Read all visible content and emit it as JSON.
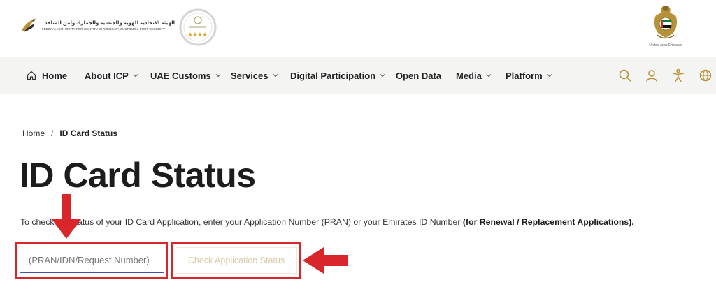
{
  "header": {
    "logo_text_ar": "الهيئة الاتحادية للهوية والجنسية والجمارك وأمن المنافذ",
    "logo_text_en": "FEDERAL AUTHORITY FOR IDENTITY, CITIZENSHIP, CUSTOMS & PORT SECURITY",
    "emblem_caption": "United Arab Emirates"
  },
  "nav": {
    "items": [
      {
        "label": "Home"
      },
      {
        "label": "About ICP"
      },
      {
        "label": "UAE Customs"
      },
      {
        "label": "Services"
      },
      {
        "label": "Digital Participation"
      },
      {
        "label": "Open Data"
      },
      {
        "label": "Media"
      },
      {
        "label": "Platform"
      }
    ],
    "icons": [
      "search-icon",
      "user-icon",
      "accessibility-icon",
      "globe-icon"
    ]
  },
  "breadcrumb": {
    "home": "Home",
    "separator": "/",
    "current": "ID Card Status"
  },
  "page": {
    "title": "ID Card Status",
    "intro_text": "To check the status of your ID Card Application, enter your Application Number (PRAN) or your Emirates ID Number ",
    "intro_bold": "(for Renewal / Replacement Applications)."
  },
  "form": {
    "input_placeholder": "(PRAN/IDN/Request Number)",
    "input_value": "",
    "submit_label": "Check Application Status"
  },
  "colors": {
    "accent_gold": "#b8923a",
    "annotation_red": "#d9262b",
    "nav_bg": "#f4f4f3"
  }
}
